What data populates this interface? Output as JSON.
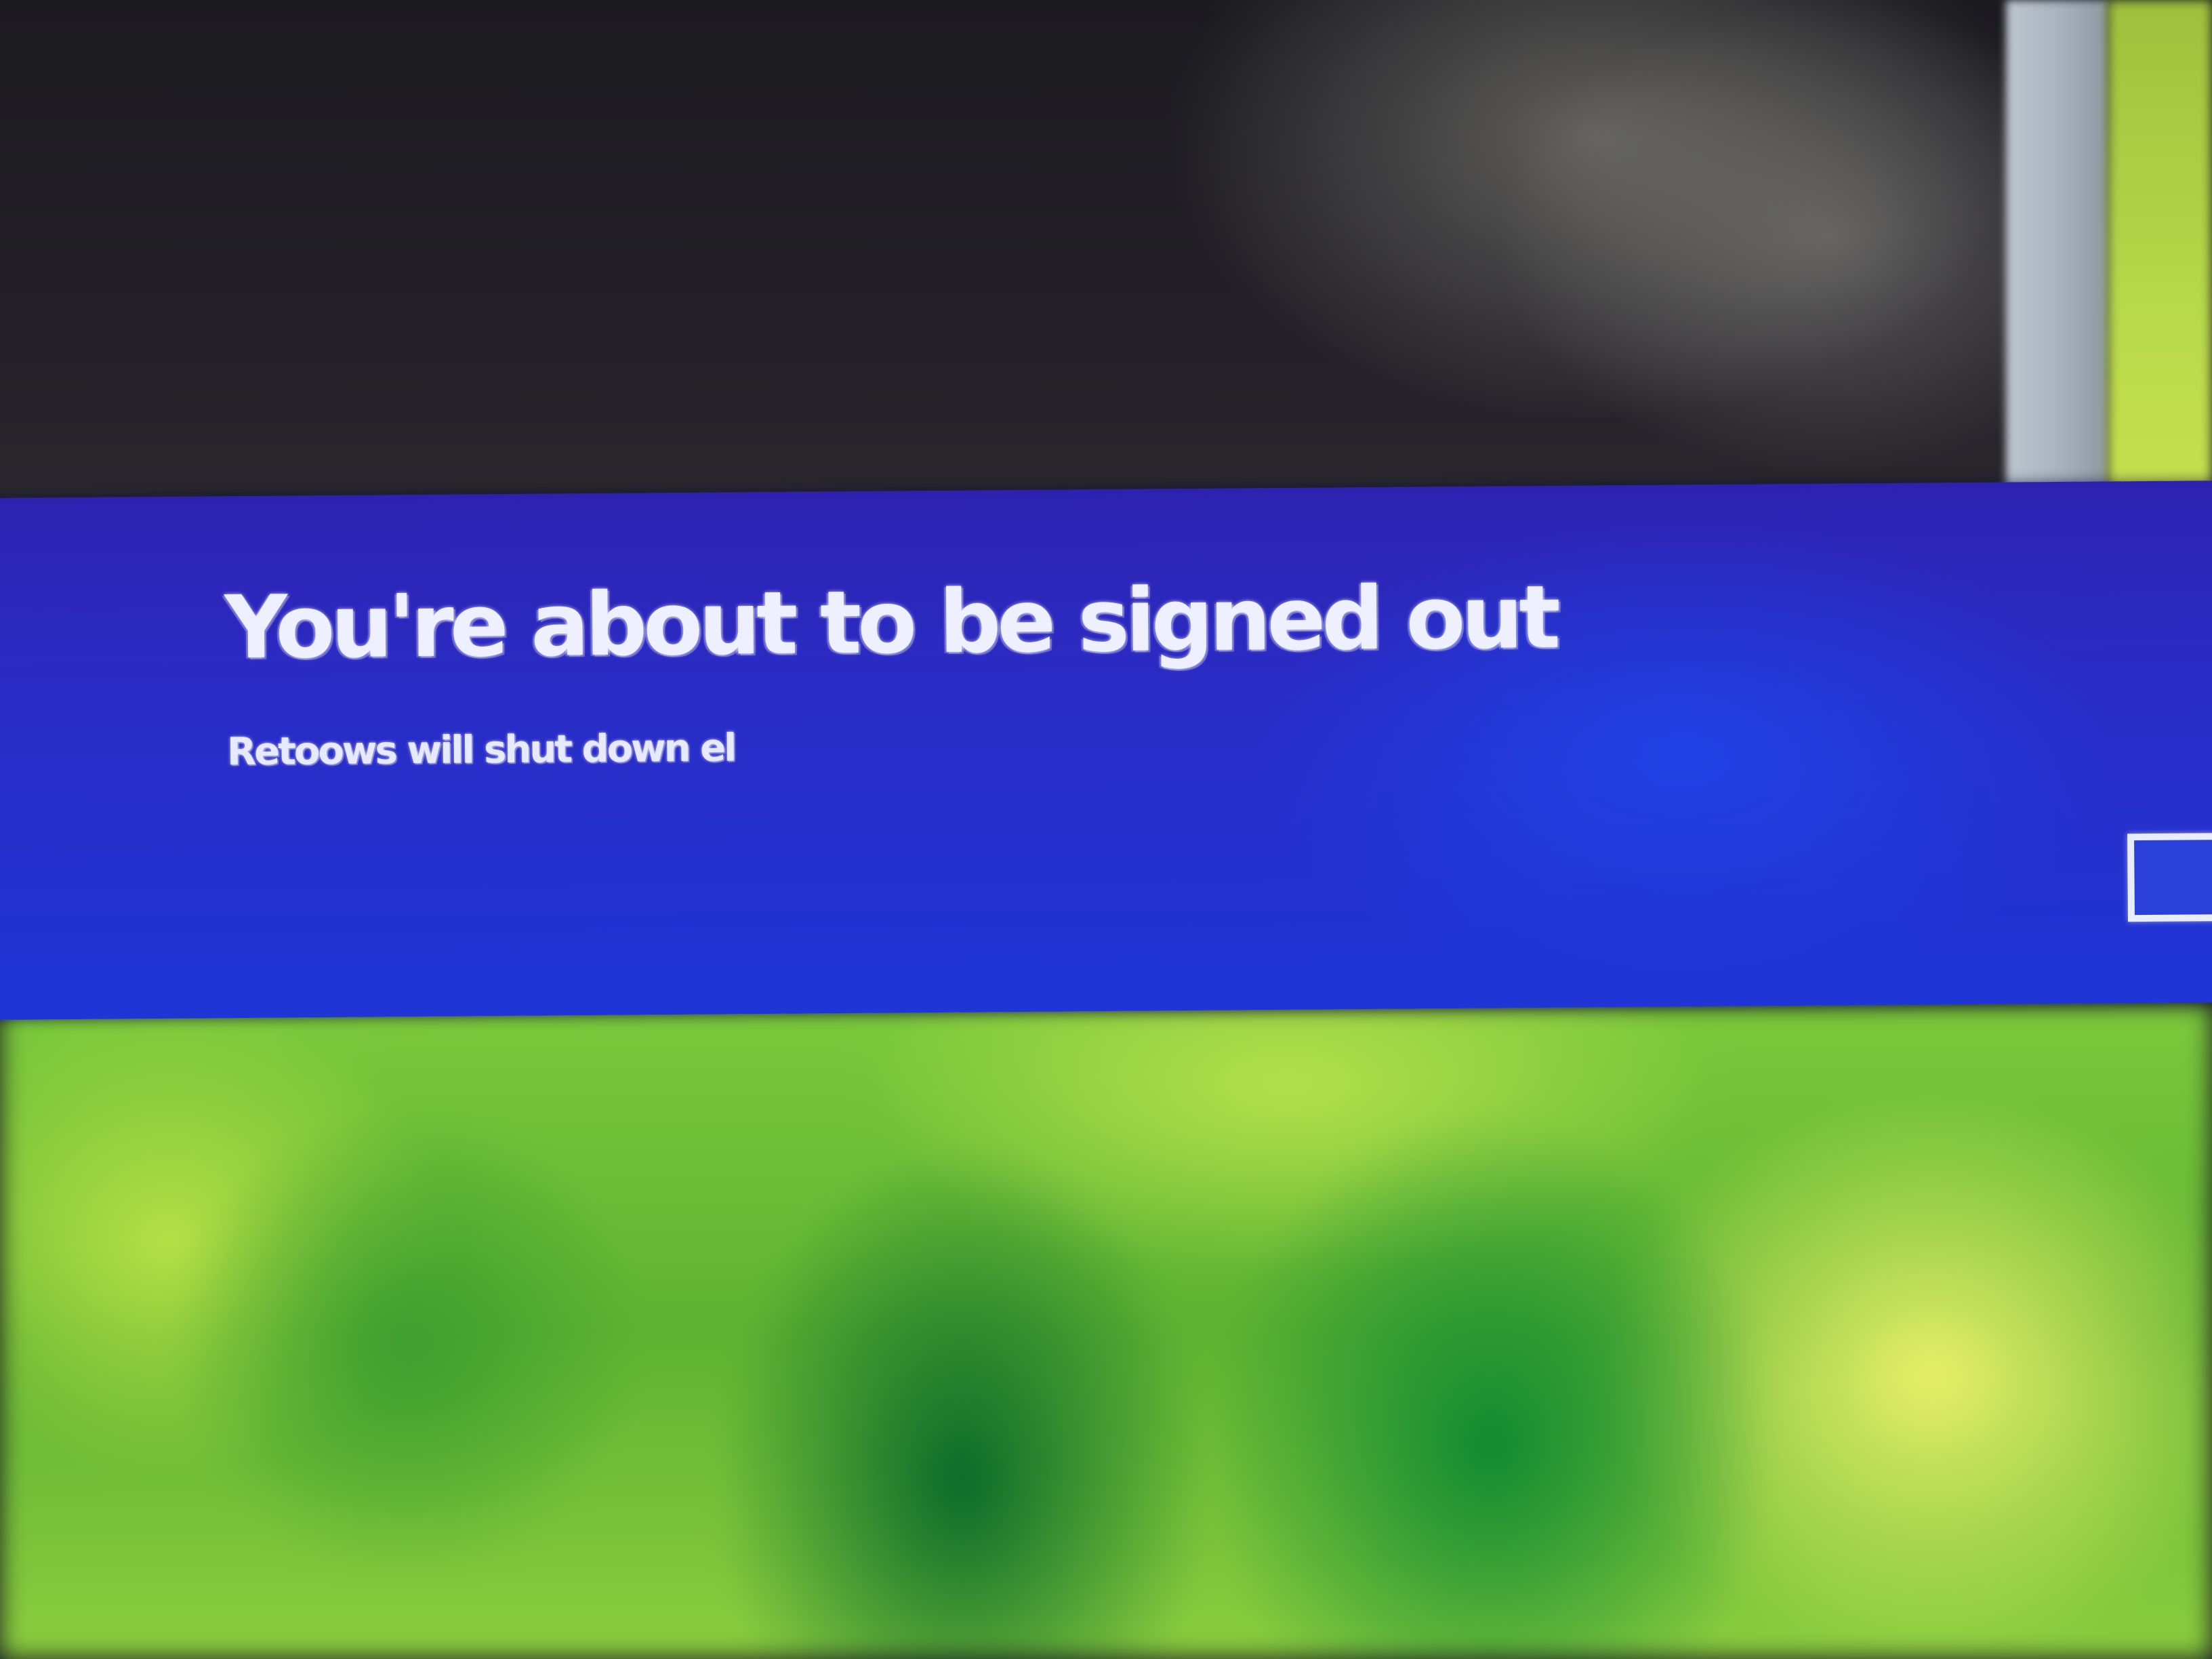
{
  "dialog": {
    "title": "You're about to be signed out",
    "message": "Retoows will shut down el",
    "button_label": ""
  },
  "colors": {
    "banner": "#2a2cc6",
    "text": "#eef0ff",
    "wallpaper_accent": "#7cc93c"
  }
}
